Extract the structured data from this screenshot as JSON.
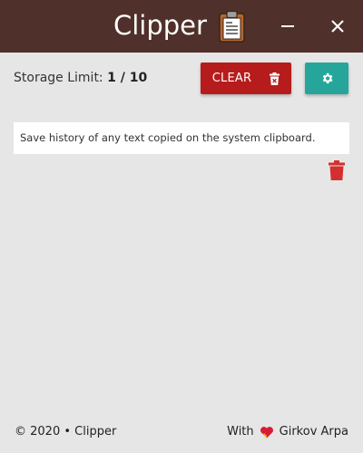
{
  "window": {
    "title": "Clipper",
    "minimize_label": "minimize",
    "close_label": "close"
  },
  "toolbar": {
    "storage_label": "Storage Limit:",
    "storage_value": "1 / 10",
    "clear_label": "CLEAR"
  },
  "entries": [
    {
      "text": "Save history of any text copied on the system clipboard."
    }
  ],
  "footer": {
    "left": "© 2020 • Clipper",
    "right_prefix": "With",
    "author": "Girkov Arpa"
  },
  "colors": {
    "titlebar": "#50302a",
    "background": "#e6e6e6",
    "clear_button": "#b71c1c",
    "settings_button": "#26a69a",
    "delete_icon": "#d32f2f"
  },
  "icons": {
    "title": "clipboard-icon",
    "minimize": "minimize-icon",
    "close": "close-icon",
    "clear": "trash-x-icon",
    "settings": "gear-icon",
    "entry_delete": "trash-icon",
    "heart": "heart-icon"
  }
}
